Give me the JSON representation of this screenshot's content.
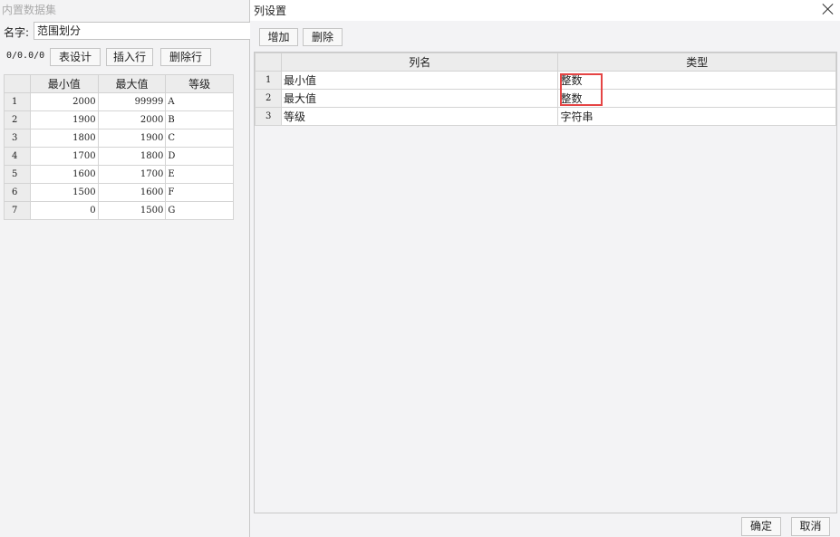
{
  "background": {
    "title": "内置数据集",
    "name_label": "名字:",
    "name_value": "范围划分",
    "counter": "0/0.0/0",
    "buttons": {
      "table_design": "表设计",
      "insert_row": "插入行",
      "delete_row": "删除行"
    },
    "table": {
      "headers": [
        "最小值",
        "最大值",
        "等级"
      ],
      "rows": [
        {
          "n": "1",
          "min": "2000",
          "max": "99999",
          "grade": "A"
        },
        {
          "n": "2",
          "min": "1900",
          "max": "2000",
          "grade": "B"
        },
        {
          "n": "3",
          "min": "1800",
          "max": "1900",
          "grade": "C"
        },
        {
          "n": "4",
          "min": "1700",
          "max": "1800",
          "grade": "D"
        },
        {
          "n": "5",
          "min": "1600",
          "max": "1700",
          "grade": "E"
        },
        {
          "n": "6",
          "min": "1500",
          "max": "1600",
          "grade": "F"
        },
        {
          "n": "7",
          "min": "0",
          "max": "1500",
          "grade": "G"
        }
      ]
    }
  },
  "dialog": {
    "title": "列设置",
    "buttons": {
      "add": "增加",
      "delete": "删除",
      "ok": "确定",
      "cancel": "取消"
    },
    "table": {
      "headers": [
        "列名",
        "类型"
      ],
      "rows": [
        {
          "n": "1",
          "name": "最小值",
          "type": "整数"
        },
        {
          "n": "2",
          "name": "最大值",
          "type": "整数"
        },
        {
          "n": "3",
          "name": "等级",
          "type": "字符串"
        }
      ]
    },
    "highlight_color": "#e54545"
  }
}
